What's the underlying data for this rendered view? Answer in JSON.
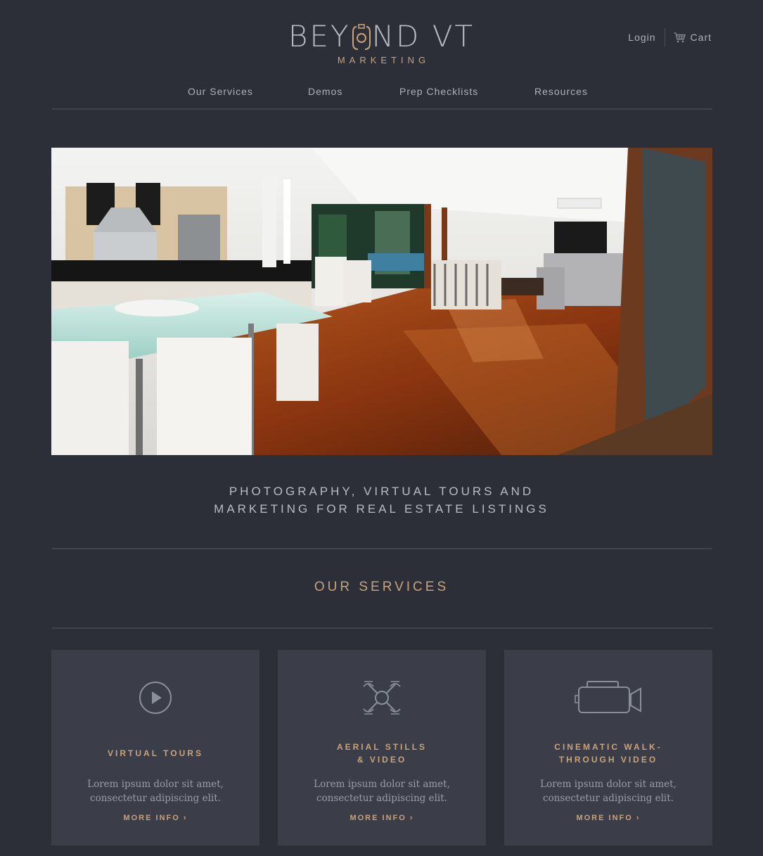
{
  "header": {
    "logo_main_left": "BEY",
    "logo_main_right": "ND VT",
    "logo_sub": "MARKETING",
    "login_label": "Login",
    "cart_label": "Cart"
  },
  "nav": {
    "items": [
      {
        "label": "Our Services"
      },
      {
        "label": "Demos"
      },
      {
        "label": "Prep Checklists"
      },
      {
        "label": "Resources"
      }
    ]
  },
  "hero": {
    "icon": "interior-living-room-photo"
  },
  "tagline": {
    "line1": "PHOTOGRAPHY, VIRTUAL TOURS AND",
    "line2": "MARKETING FOR REAL ESTATE LISTINGS"
  },
  "services": {
    "title": "OUR SERVICES",
    "cards": [
      {
        "icon": "play-icon",
        "title_line1": "VIRTUAL TOURS",
        "title_line2": "",
        "text_line1": "Lorem ipsum dolor sit amet,",
        "text_line2": "consectetur adipiscing elit.",
        "link": "MORE INFO"
      },
      {
        "icon": "drone-icon",
        "title_line1": "AERIAL STILLS",
        "title_line2": "& VIDEO",
        "text_line1": "Lorem ipsum dolor sit amet,",
        "text_line2": "consectetur adipiscing elit.",
        "link": "MORE INFO"
      },
      {
        "icon": "video-camera-icon",
        "title_line1": "CINEMATIC WALK-",
        "title_line2": "THROUGH VIDEO",
        "text_line1": "Lorem ipsum dolor sit amet,",
        "text_line2": "consectetur adipiscing elit.",
        "link": "MORE INFO"
      }
    ]
  },
  "colors": {
    "background": "#2c2f38",
    "card_background": "#3b3e49",
    "accent_gold": "#c8a27a",
    "text_light": "#b9bcc5"
  }
}
